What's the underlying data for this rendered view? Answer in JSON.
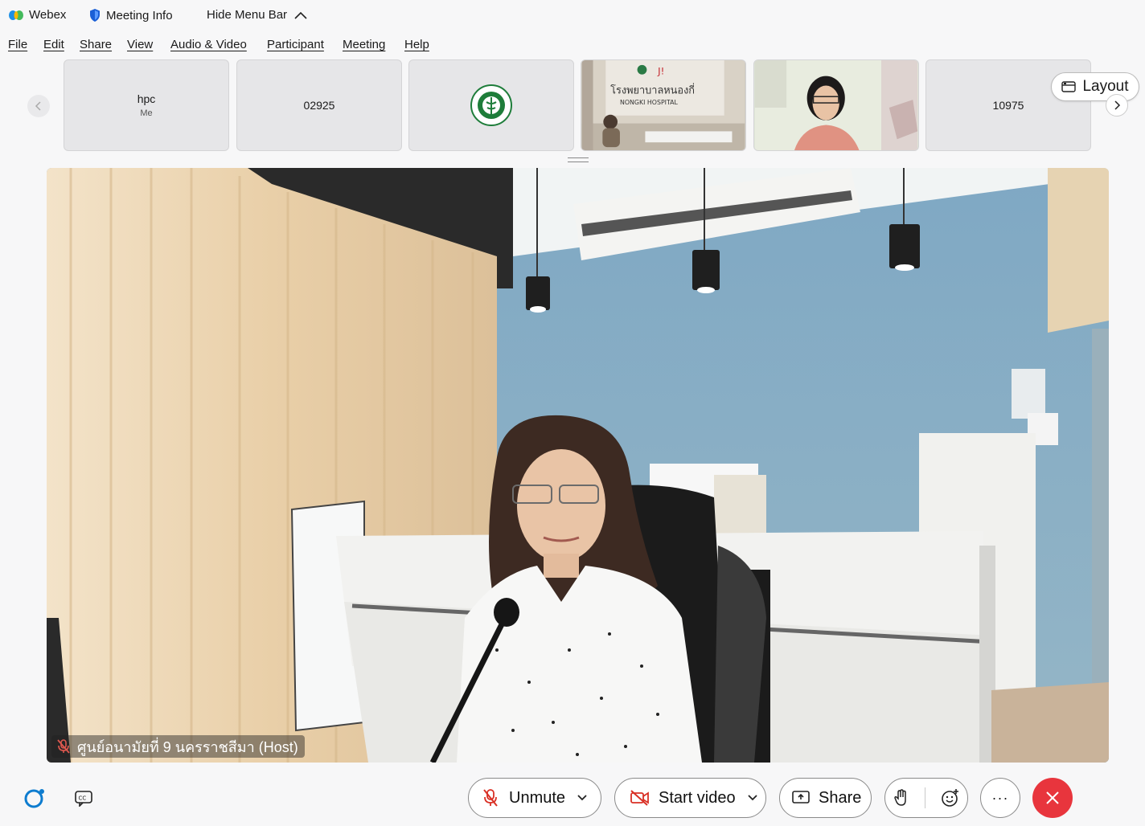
{
  "titlebar": {
    "app_name": "Webex",
    "meeting_info": "Meeting Info",
    "hide_menu_bar": "Hide Menu Bar"
  },
  "menu": [
    "File",
    "Edit",
    "Share",
    "View",
    "Audio & Video",
    "Participant",
    "Meeting",
    "Help"
  ],
  "participants": [
    {
      "name": "hpc",
      "sub": "Me",
      "kind": "name"
    },
    {
      "name": "02925",
      "kind": "name"
    },
    {
      "name": "",
      "kind": "logo"
    },
    {
      "name": "",
      "kind": "video-room",
      "sign": "โรงพยาบาลหนองกี่",
      "sign_en": "NONGKI HOSPITAL"
    },
    {
      "name": "",
      "kind": "video-person"
    },
    {
      "name": "10975",
      "kind": "name"
    }
  ],
  "layout_button": "Layout",
  "active_speaker": {
    "label": "ศูนย์อนามัยที่ 9 นครราชสีมา (Host)",
    "muted": true
  },
  "controls": {
    "unmute": "Unmute",
    "start_video": "Start video",
    "share": "Share",
    "more": "···"
  },
  "colors": {
    "leave": "#e8353d",
    "muted_red": "#d93025",
    "wall_blue": "#8fb3c9"
  }
}
